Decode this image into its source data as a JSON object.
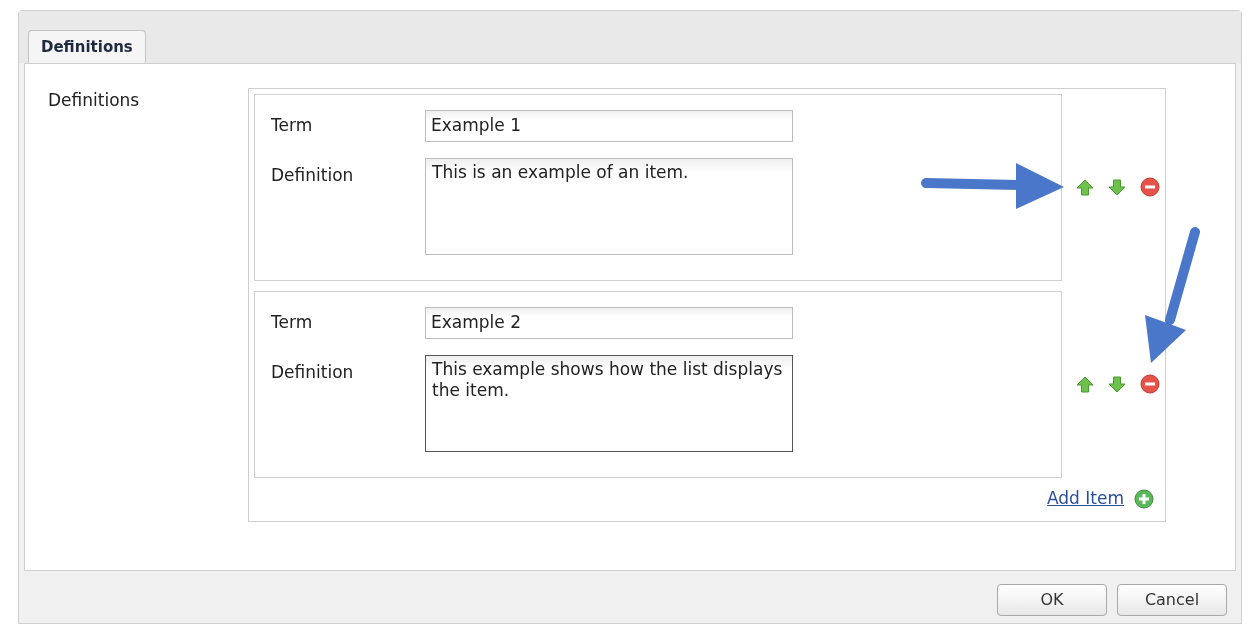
{
  "tabs": [
    {
      "label": "Definitions",
      "selected": true
    }
  ],
  "field_label": "Definitions",
  "items": [
    {
      "term_label": "Term",
      "term": "Example 1",
      "definition_label": "Definition",
      "definition": "This is an example of an item.",
      "focused": false
    },
    {
      "term_label": "Term",
      "term": "Example 2",
      "definition_label": "Definition",
      "definition": "This example shows how the list displays the item.",
      "focused": true
    }
  ],
  "add_item": "Add Item",
  "buttons": [
    "OK",
    "Cancel"
  ]
}
